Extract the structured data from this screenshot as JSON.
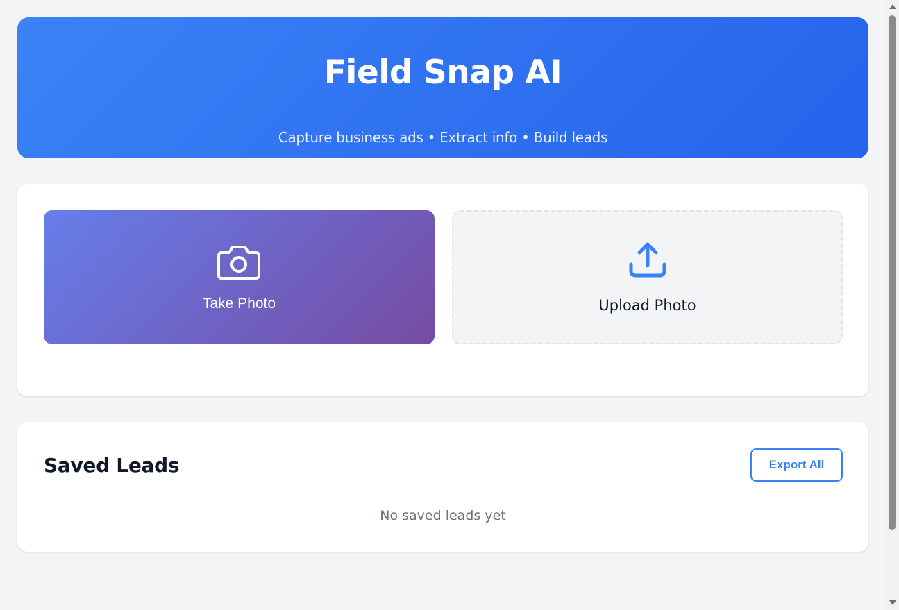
{
  "header": {
    "title": "Field Snap AI",
    "subtitle": "Capture business ads • Extract info • Build leads"
  },
  "capture": {
    "take_photo_label": "Take Photo",
    "upload_photo_label": "Upload Photo",
    "take_photo_icon": "camera-icon",
    "upload_photo_icon": "upload-icon"
  },
  "leads": {
    "title": "Saved Leads",
    "export_label": "Export All",
    "empty_message": "No saved leads yet"
  },
  "colors": {
    "header_gradient_start": "#3b82f6",
    "header_gradient_end": "#2563eb",
    "take_photo_gradient_start": "#667eea",
    "take_photo_gradient_end": "#764ba2",
    "accent": "#3b82f6",
    "page_background": "#f3f4f6"
  }
}
